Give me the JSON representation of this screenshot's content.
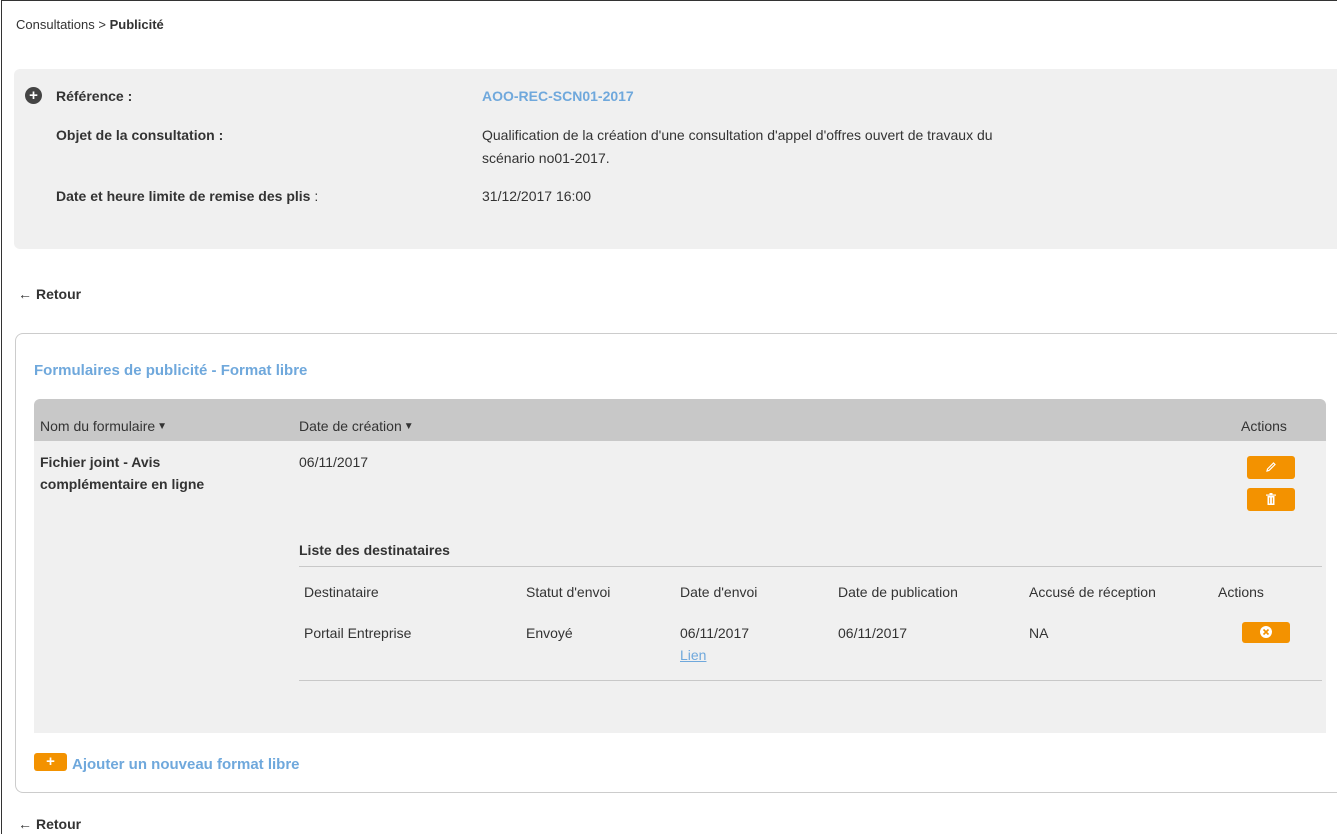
{
  "breadcrumb": {
    "parent": "Consultations",
    "separator": " > ",
    "current": "Publicité"
  },
  "summary": {
    "reference_label": "Référence :",
    "reference_value": "AOO-REC-SCN01-2017",
    "objet_label": "Objet de la consultation :",
    "objet_value_line1": "Qualification de la création d'une consultation d'appel d'offres ouvert de travaux du",
    "objet_value_line2": "scénario no01-2017.",
    "date_label": "Date et heure limite de remise des plis",
    "date_label_suffix": " :",
    "date_value": "31/12/2017 16:00"
  },
  "retour_label": "Retour",
  "panel": {
    "title": "Formulaires de publicité - Format libre",
    "columns": {
      "nom": "Nom du formulaire",
      "date": "Date de création",
      "actions": "Actions"
    },
    "row": {
      "nom_line1": "Fichier joint - Avis",
      "nom_line2": "complémentaire en ligne",
      "date": "06/11/2017"
    },
    "recipients": {
      "title": "Liste des destinataires",
      "columns": [
        "Destinataire",
        "Statut d'envoi",
        "Date d'envoi",
        "Date de publication",
        "Accusé de réception",
        "Actions"
      ],
      "row": {
        "destinataire": "Portail Entreprise",
        "statut": "Envoyé",
        "date_envoi": "06/11/2017",
        "lien": "Lien",
        "date_publication": "06/11/2017",
        "accuse": "NA"
      }
    },
    "add_button_label": "Ajouter un nouveau format libre"
  },
  "colors": {
    "accent_orange": "#f39200",
    "link_blue": "#6fa8dc",
    "panel_gray": "#f0f0f0",
    "header_gray": "#c8c8c8"
  }
}
